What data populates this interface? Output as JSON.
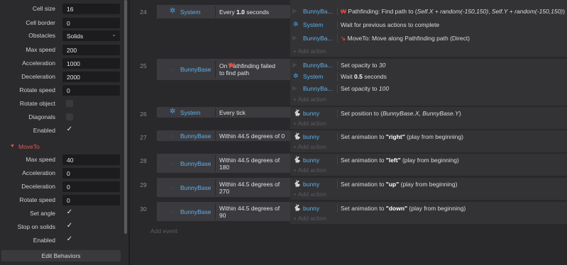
{
  "properties": {
    "rows": [
      {
        "label": "Cell size",
        "type": "input",
        "value": "16"
      },
      {
        "label": "Cell border",
        "type": "input",
        "value": "0"
      },
      {
        "label": "Obstacles",
        "type": "select",
        "value": "Solids"
      },
      {
        "label": "Max speed",
        "type": "input",
        "value": "200"
      },
      {
        "label": "Acceleration",
        "type": "input",
        "value": "1000"
      },
      {
        "label": "Deceleration",
        "type": "input",
        "value": "2000"
      },
      {
        "label": "Rotate speed",
        "type": "input",
        "value": "0"
      },
      {
        "label": "Rotate object",
        "type": "check",
        "checked": false
      },
      {
        "label": "Diagonals",
        "type": "check",
        "checked": false
      },
      {
        "label": "Enabled",
        "type": "check",
        "checked": true
      }
    ],
    "moveto_title": "MoveTo",
    "moveto_rows": [
      {
        "label": "Max speed",
        "type": "input",
        "value": "40"
      },
      {
        "label": "Acceleration",
        "type": "input",
        "value": "0"
      },
      {
        "label": "Deceleration",
        "type": "input",
        "value": "0"
      },
      {
        "label": "Rotate speed",
        "type": "input",
        "value": "0"
      },
      {
        "label": "Set angle",
        "type": "check",
        "checked": true
      },
      {
        "label": "Stop on solids",
        "type": "check",
        "checked": true
      },
      {
        "label": "Enabled",
        "type": "check",
        "checked": true
      }
    ],
    "edit_behaviors": "Edit Behaviors"
  },
  "events": [
    {
      "num": "24",
      "object": "System",
      "condition_pre": "Every ",
      "condition_bold": "1.0",
      "condition_post": " seconds",
      "actions": [
        {
          "object": "BunnyBa...",
          "text_pre": "Pathfinding: Find path to (",
          "text_italic": "Self.X + random(-150,150)",
          "text_mid": ", ",
          "text_italic2": "Self.Y + random(-150,150)",
          "text_post": ")"
        },
        {
          "object": "System",
          "text": "Wait for previous actions to complete"
        },
        {
          "object": "BunnyBa...",
          "text": "MoveTo: Move along Pathfinding path (Direct)"
        }
      ],
      "add_action": "Add action"
    },
    {
      "num": "25",
      "object": "BunnyBase",
      "condition_line1": "On  Pathfinding failed",
      "condition_line2": "to find path",
      "actions": [
        {
          "object": "BunnyBa...",
          "text_pre": "Set opacity to ",
          "text_italic": "30"
        },
        {
          "object": "System",
          "text_pre": "Wait ",
          "text_bold": "0.5",
          "text_post": " seconds"
        },
        {
          "object": "BunnyBa...",
          "text_pre": "Set opacity to ",
          "text_italic": "100"
        }
      ],
      "add_action": "Add action"
    },
    {
      "num": "26",
      "object": "System",
      "condition": "Every tick",
      "actions": [
        {
          "object": "bunny",
          "text_pre": "Set position to (",
          "text_italic": "BunnyBase.X, BunnyBase.Y",
          "text_post": ")"
        }
      ],
      "add_action": "Add action"
    },
    {
      "num": "27",
      "object": "BunnyBase",
      "condition_line1": "Within 44.5 degrees of 0",
      "actions": [
        {
          "object": "bunny",
          "text_pre": "Set animation to ",
          "text_bold": "\"right\"",
          "text_post": " (play from beginning)"
        }
      ],
      "add_action": "Add action"
    },
    {
      "num": "28",
      "object": "BunnyBase",
      "condition_line1": "Within 44.5 degrees of",
      "condition_line2": "180",
      "actions": [
        {
          "object": "bunny",
          "text_pre": "Set animation to ",
          "text_bold": "\"left\"",
          "text_post": " (play from beginning)"
        }
      ],
      "add_action": "Add action"
    },
    {
      "num": "29",
      "object": "BunnyBase",
      "condition_line1": "Within 44.5 degrees of",
      "condition_line2": "270",
      "actions": [
        {
          "object": "bunny",
          "text_pre": "Set animation to ",
          "text_bold": "\"up\"",
          "text_post": " (play from beginning)"
        }
      ],
      "add_action": "Add action"
    },
    {
      "num": "30",
      "object": "BunnyBase",
      "condition_line1": "Within 44.5 degrees of",
      "condition_line2": "90",
      "actions": [
        {
          "object": "bunny",
          "text_pre": "Set animation to ",
          "text_bold": "\"down\"",
          "text_post": " (play from beginning)"
        }
      ],
      "add_action": "Add action"
    }
  ],
  "add_event": "Add event",
  "colors": {
    "accent_blue": "#5fb0e8",
    "moveto_red": "#e05a4f",
    "trigger_green": "#2fcf7c"
  },
  "icons": [
    "gear-icon",
    "bunny-icon",
    "pathfinding-icon",
    "moveto-icon",
    "trigger-arrow-icon",
    "checkmark-icon",
    "chevron-down-icon",
    "plus-icon"
  ]
}
